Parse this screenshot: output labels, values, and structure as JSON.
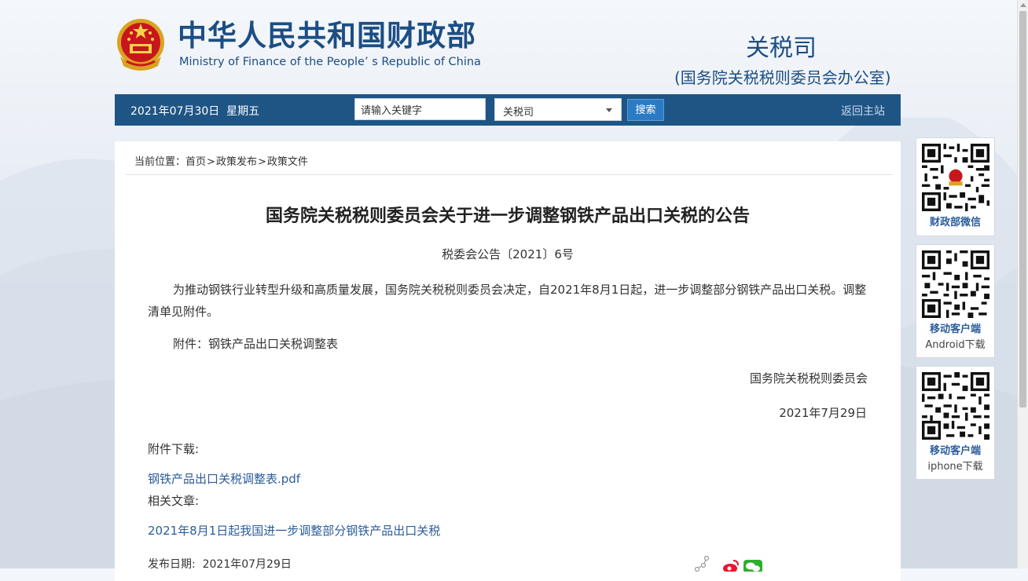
{
  "header": {
    "ministry_cn": "中华人民共和国财政部",
    "ministry_en": "Ministry of Finance of the People’ s Republic of China",
    "department": "关税司",
    "department_sub": "(国务院关税税则委员会办公室)",
    "emblem_icon": "national-emblem-icon"
  },
  "navbar": {
    "date": "2021年07月30日  星期五",
    "search_placeholder": "请输入关键字",
    "scope_select": "关税司",
    "search_button": "搜索",
    "back_link": "返回主站",
    "bar_color": "#1f5585"
  },
  "breadcrumb": {
    "label": "当前位置：",
    "items": [
      "首页",
      "政策发布",
      "政策文件"
    ],
    "separator": ">"
  },
  "article": {
    "title": "国务院关税税则委员会关于进一步调整钢铁产品出口关税的公告",
    "doc_number": "税委会公告〔2021〕6号",
    "body": "为推动钢铁行业转型升级和高质量发展，国务院关税税则委员会决定，自2021年8月1日起，进一步调整部分钢铁产品出口关税。调整清单见附件。",
    "attachment_line": "附件：钢铁产品出口关税调整表",
    "signature_org": "国务院关税税则委员会",
    "signature_date": "2021年7月29日",
    "download_label": "附件下载:",
    "download_link": "钢铁产品出口关税调整表.pdf",
    "related_label": "相关文章:",
    "related_link": "2021年8月1日起我国进一步调整部分钢铁产品出口关税",
    "publish_date": "发布日期:  2021年07月29日",
    "link_color": "#2b5d9b"
  },
  "qr": [
    {
      "label": "财政部微信",
      "sub": ""
    },
    {
      "label": "移动客户端",
      "sub": "Android下载"
    },
    {
      "label": "移动客户端",
      "sub": "iphone下载"
    }
  ]
}
